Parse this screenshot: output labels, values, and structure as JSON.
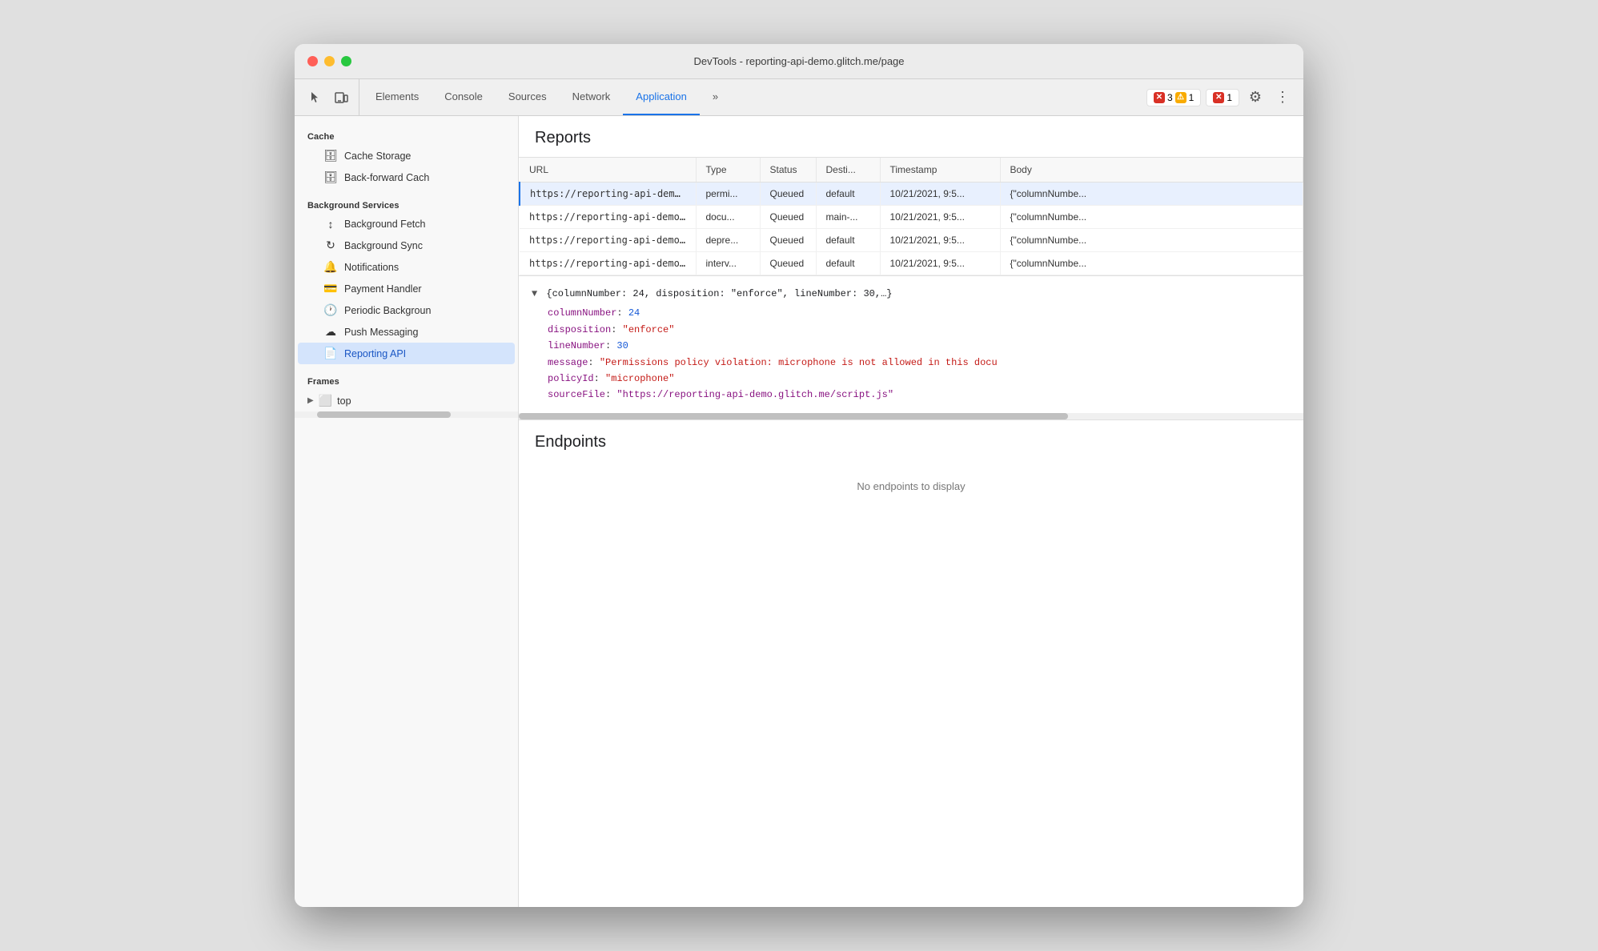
{
  "window": {
    "title": "DevTools - reporting-api-demo.glitch.me/page"
  },
  "toolbar": {
    "tabs": [
      {
        "label": "Elements",
        "active": false
      },
      {
        "label": "Console",
        "active": false
      },
      {
        "label": "Sources",
        "active": false
      },
      {
        "label": "Network",
        "active": false
      },
      {
        "label": "Application",
        "active": true
      },
      {
        "label": "»",
        "active": false
      }
    ],
    "errors": {
      "red_count": "3",
      "yellow_count": "1",
      "error_count": "1"
    }
  },
  "sidebar": {
    "cache_section": "Cache",
    "cache_storage": "Cache Storage",
    "back_forward": "Back-forward Cach",
    "background_services": "Background Services",
    "background_fetch": "Background Fetch",
    "background_sync": "Background Sync",
    "notifications": "Notifications",
    "payment_handler": "Payment Handler",
    "periodic_background": "Periodic Backgroun",
    "push_messaging": "Push Messaging",
    "reporting_api": "Reporting API",
    "frames_section": "Frames",
    "top_frame": "top"
  },
  "reports": {
    "title": "Reports",
    "columns": [
      "URL",
      "Type",
      "Status",
      "Desti...",
      "Timestamp",
      "Body"
    ],
    "rows": [
      {
        "url": "https://reporting-api-demo...",
        "type": "permi...",
        "status": "Queued",
        "dest": "default",
        "timestamp": "10/21/2021, 9:5...",
        "body": "{\"columnNumbe...",
        "selected": true
      },
      {
        "url": "https://reporting-api-demo...",
        "type": "docu...",
        "status": "Queued",
        "dest": "main-...",
        "timestamp": "10/21/2021, 9:5...",
        "body": "{\"columnNumbe...",
        "selected": false
      },
      {
        "url": "https://reporting-api-demo...",
        "type": "depre...",
        "status": "Queued",
        "dest": "default",
        "timestamp": "10/21/2021, 9:5...",
        "body": "{\"columnNumbe...",
        "selected": false
      },
      {
        "url": "https://reporting-api-demo...",
        "type": "interv...",
        "status": "Queued",
        "dest": "default",
        "timestamp": "10/21/2021, 9:5...",
        "body": "{\"columnNumbe...",
        "selected": false
      }
    ],
    "detail": {
      "summary": "{columnNumber: 24, disposition: \"enforce\", lineNumber: 30,…}",
      "fields": [
        {
          "key": "columnNumber",
          "colon": ": ",
          "value": "24",
          "type": "number"
        },
        {
          "key": "disposition",
          "colon": ": ",
          "value": "\"enforce\"",
          "type": "string"
        },
        {
          "key": "lineNumber",
          "colon": ": ",
          "value": "30",
          "type": "number"
        },
        {
          "key": "message",
          "colon": ": ",
          "value": "\"Permissions policy violation: microphone is not allowed in this docu",
          "type": "string"
        },
        {
          "key": "policyId",
          "colon": ": ",
          "value": "\"microphone\"",
          "type": "string"
        },
        {
          "key": "sourceFile",
          "colon": ": ",
          "value": "\"https://reporting-api-demo.glitch.me/script.js\"",
          "type": "url"
        }
      ]
    }
  },
  "endpoints": {
    "title": "Endpoints",
    "empty_message": "No endpoints to display"
  }
}
